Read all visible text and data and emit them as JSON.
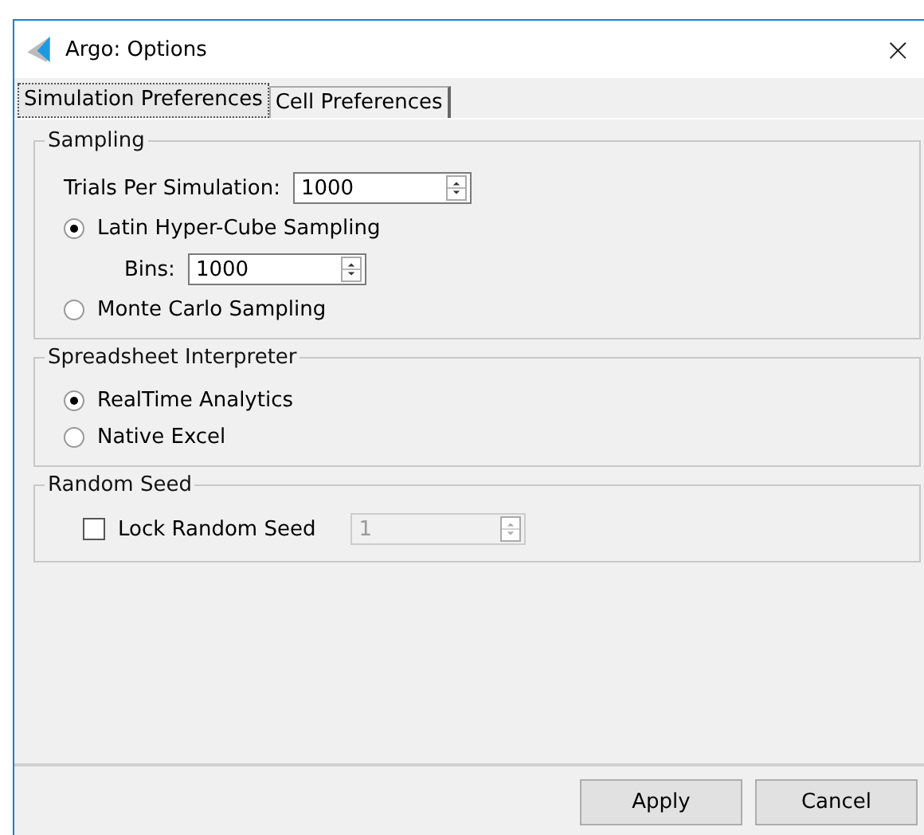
{
  "window": {
    "title": "Argo: Options",
    "close": "×"
  },
  "tabs": [
    {
      "label": "Simulation Preferences",
      "selected": true
    },
    {
      "label": "Cell Preferences",
      "selected": false
    }
  ],
  "groups": [
    {
      "title": "Sampling",
      "items": [
        {
          "kind": "spinner",
          "label": "Trials Per Simulation:",
          "value": "1000",
          "disabled": false,
          "indent": false
        },
        {
          "kind": "radio",
          "label": "Latin Hyper-Cube Sampling",
          "selected": true
        },
        {
          "kind": "spinner",
          "label": "Bins:",
          "value": "1000",
          "disabled": false,
          "indent": true
        },
        {
          "kind": "radio",
          "label": "Monte Carlo Sampling",
          "selected": false
        }
      ]
    },
    {
      "title": "Spreadsheet Interpreter",
      "items": [
        {
          "kind": "radio",
          "label": "RealTime Analytics",
          "selected": true
        },
        {
          "kind": "radio",
          "label": "Native Excel",
          "selected": false
        }
      ]
    },
    {
      "title": "Random Seed",
      "items": [
        {
          "kind": "checkbox",
          "label": "Lock Random Seed",
          "checked": false,
          "value": "1",
          "disabled": true
        }
      ]
    }
  ],
  "buttons": [
    "Apply",
    "Cancel"
  ]
}
